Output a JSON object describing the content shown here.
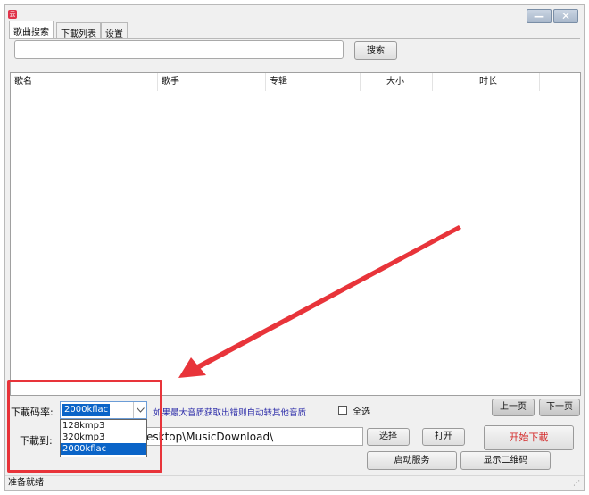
{
  "window": {
    "app_icon_text": "云",
    "minimize_label": "—",
    "close_label": "✕"
  },
  "tabs": [
    {
      "label": "歌曲搜索",
      "active": true
    },
    {
      "label": "下載列表",
      "active": false
    },
    {
      "label": "设置",
      "active": false
    }
  ],
  "search": {
    "value": "",
    "button_label": "搜索"
  },
  "table": {
    "columns": [
      "歌名",
      "歌手",
      "专辑",
      "大小",
      "时长"
    ],
    "rows": []
  },
  "bitrate": {
    "label": "下載码率:",
    "selected": "2000kflac",
    "options": [
      "128kmp3",
      "320kmp3",
      "2000kflac"
    ]
  },
  "hint_text": "如果最大音质获取出错则自动转其他音质",
  "select_all_label": "全选",
  "select_all_checked": false,
  "paging": {
    "prev_label": "上一页",
    "next_label": "下一页"
  },
  "download": {
    "label": "下載到:",
    "path_visible": "esktop\\MusicDownload\\",
    "choose_label": "选择",
    "open_label": "打开",
    "start_label": "开始下載",
    "service_label": "启动服务",
    "qr_label": "显示二维码"
  },
  "status": {
    "text": "准备就绪"
  },
  "annotation": {
    "color": "#e8343a"
  }
}
